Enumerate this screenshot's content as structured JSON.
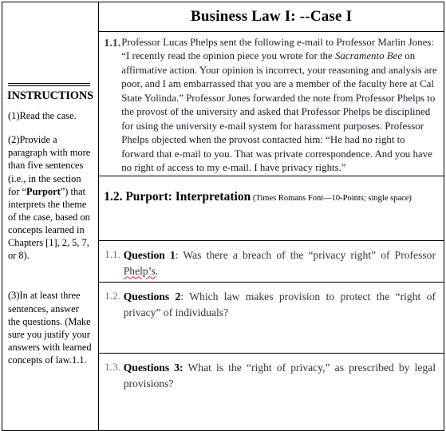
{
  "document": {
    "title": "Business Law I: --Case I"
  },
  "instructions": {
    "heading": "INSTRUCTIONS",
    "items": [
      {
        "num": "(1)",
        "text": "Read the case."
      },
      {
        "num": "(2)",
        "text_before": "Provide a paragraph with more than five sentences (i.e., in the section for “",
        "bold": "Purport",
        "text_after": "”) that interprets the theme of the case, based on concepts learned in Chapters [1], 2, 5, 7, or 8)."
      },
      {
        "num": "(3)",
        "text": "In at least three sentences, answer the questions. (Make sure you justify your answers with learned concepts of law.1.1."
      }
    ]
  },
  "case": {
    "number": "1.1.",
    "text_part1": "Professor Lucas Phelps sent the following e-mail to Professor Marlin Jones: “I recently read the opinion piece you wrote for the ",
    "italic": "Sacramento Bee",
    "text_part2": " on affirmative action. Your opinion is incorrect, your reasoning and analysis are poor, and I am embarrassed that you are a member of the faculty here at Cal State Yolinda.” Professor Jones forwarded the note from Professor Phelps to the provost of the university and asked that Professor Phelps be disciplined for using the university e-mail system for harassment purposes. Professor Phelps objected when the provost contacted him: “He had no right to forward that e-mail to you. That was private correspondence. And you have no right of access to my e-mail. I have privacy rights.”"
  },
  "purport": {
    "heading": "1.2.  Purport:  Interpretation",
    "note": " (Times Romans Font—10-Points; single space)"
  },
  "questions": [
    {
      "num": "1.1.",
      "label": "Question 1",
      "separator": ":",
      "text": "  Was  there  a  breach  of  the  “privacy  right”  of  Professor ",
      "misspelled": "Phelp’s",
      "text_after": "."
    },
    {
      "num": "1.2.",
      "label": "Questions 2",
      "separator": ":",
      "text": "  Which  law  makes  provision  to  protect  the  “right  of privacy” of individuals?",
      "misspelled": "",
      "text_after": ""
    },
    {
      "num": "1.3.",
      "label": "Questions 3:",
      "separator": "",
      "text": "  What  is  the  “right  of  privacy,”  as  prescribed  by  legal provisions?",
      "misspelled": "",
      "text_after": ""
    }
  ],
  "colors": {
    "border": "#000000",
    "body_text": "#1b1b28",
    "number_gray": "#6a6a78",
    "spellcheck_underline": "#e02020"
  }
}
